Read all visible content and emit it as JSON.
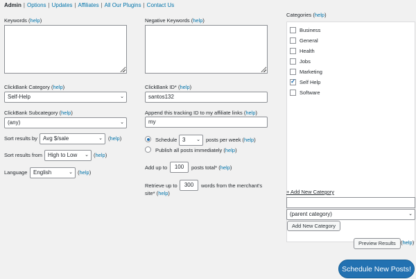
{
  "tabs": {
    "admin": "Admin",
    "options": "Options",
    "updates": "Updates",
    "affiliates": "Affiliates",
    "plugins": "All Our Plugins",
    "contact": "Contact Us"
  },
  "help": "help",
  "keywords": {
    "label": "Keywords",
    "value": ""
  },
  "negative_keywords": {
    "label": "Negative Keywords",
    "value": ""
  },
  "clickbank_category": {
    "label": "ClickBank Category",
    "value": "Self-Help"
  },
  "clickbank_id": {
    "label": "ClickBank ID*",
    "value": "santos132"
  },
  "clickbank_subcategory": {
    "label": "ClickBank Subcategory",
    "value": "(any)"
  },
  "tracking": {
    "label": "Append this tracking ID to my affiliate links",
    "value": "my"
  },
  "sort_by": {
    "label": "Sort results by",
    "value": "Avg $/sale"
  },
  "sort_from": {
    "label": "Sort results from",
    "value": "High to Low"
  },
  "language": {
    "label": "Language",
    "value": "English"
  },
  "schedule": {
    "label_pre": "Schedule",
    "value": "3",
    "label_post": "posts per week"
  },
  "publish_all": {
    "label": "Publish all posts immediately"
  },
  "add_up_to": {
    "label_pre": "Add up to",
    "value": "100",
    "label_post": "posts total*"
  },
  "retrieve": {
    "label_pre": "Retrieve up to",
    "value": "300",
    "label_post": "words from the merchant's",
    "label_line2": "site*"
  },
  "categories": {
    "label": "Categories",
    "items": [
      {
        "name": "Business",
        "checked": false
      },
      {
        "name": "General",
        "checked": false
      },
      {
        "name": "Health",
        "checked": false
      },
      {
        "name": "Jobs",
        "checked": false
      },
      {
        "name": "Marketing",
        "checked": false
      },
      {
        "name": "Self Help",
        "checked": true
      },
      {
        "name": "Software",
        "checked": false
      }
    ],
    "add_new_link": "+ Add New Category",
    "new_name_value": "",
    "parent_select": "(parent category)",
    "add_button": "Add New Category"
  },
  "preview_button": "Preview Results",
  "submit_button": "Schedule New Posts!",
  "colors": {
    "accent": "#2271b1",
    "link": "#0073aa",
    "background": "#f1f1f1"
  }
}
